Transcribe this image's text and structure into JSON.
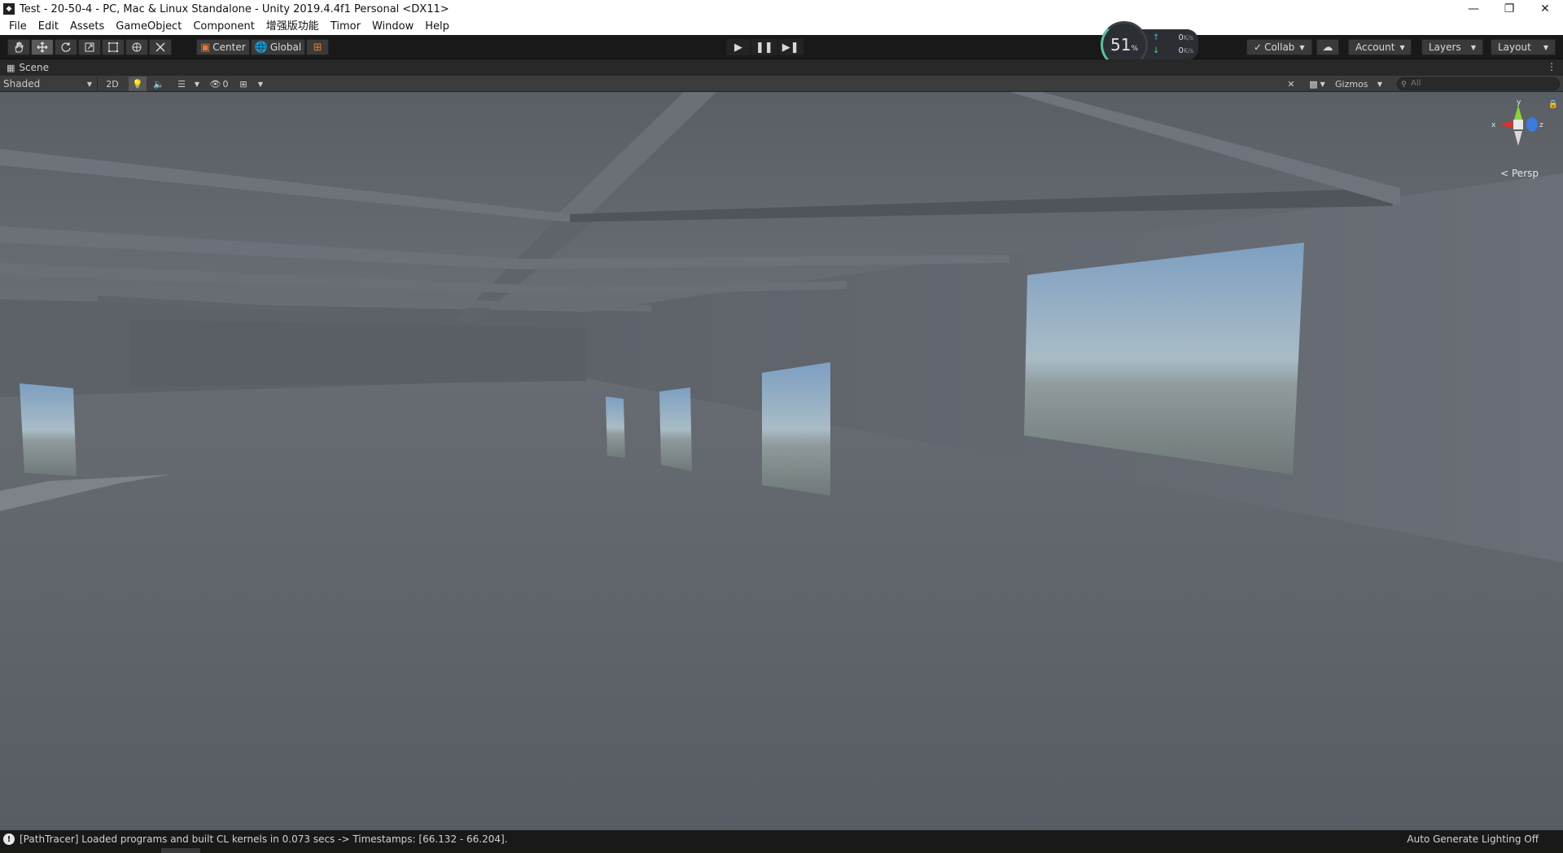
{
  "window": {
    "title": "Test - 20-50-4 - PC, Mac & Linux Standalone - Unity 2019.4.4f1 Personal <DX11>",
    "icon": "unity-icon",
    "controls": [
      "minimize-icon",
      "restore-icon",
      "close-icon"
    ]
  },
  "menubar": {
    "items": [
      "File",
      "Edit",
      "Assets",
      "GameObject",
      "Component",
      "增强版功能",
      "Timor",
      "Window",
      "Help"
    ]
  },
  "toolbar": {
    "tools": [
      "hand-tool",
      "move-tool",
      "rotate-tool",
      "scale-tool",
      "rect-tool",
      "transform-tool",
      "custom-editor-tool"
    ],
    "active_tool": "move-tool",
    "pivot_label": "Center",
    "space_label": "Global",
    "play_controls": [
      "play-icon",
      "pause-icon",
      "step-icon"
    ],
    "collab_label": "Collab",
    "account_label": "Account",
    "layers_label": "Layers",
    "layout_label": "Layout"
  },
  "perf_widget": {
    "percent": "51",
    "percent_unit": "%",
    "upload_value": "0",
    "download_value": "0",
    "rate_unit": "K/s"
  },
  "scene_tab": {
    "label": "Scene"
  },
  "scene_toolbar": {
    "shading_mode": "Shaded",
    "mode_2d_label": "2D",
    "hidden_count": "0",
    "gizmos_label": "Gizmos",
    "search_placeholder": "All"
  },
  "orientation_gizmo": {
    "x_label": "x",
    "y_label": "y",
    "z_label": "z",
    "projection_label": "Persp"
  },
  "status_bar": {
    "message": "[PathTracer] Loaded programs and built CL kernels in 0.073 secs -> Timestamps: [66.132 - 66.204].",
    "right_text": "Auto Generate Lighting Off"
  },
  "colors": {
    "editor_bg": "#191919",
    "scene_wall": "#5c6068",
    "sky_top": "#7d9fc2",
    "sky_horizon": "#a9bcc6",
    "ground_outside": "#707878",
    "gizmo_x": "#d9332b",
    "gizmo_y": "#8ad43a",
    "gizmo_z": "#3a7be0"
  }
}
